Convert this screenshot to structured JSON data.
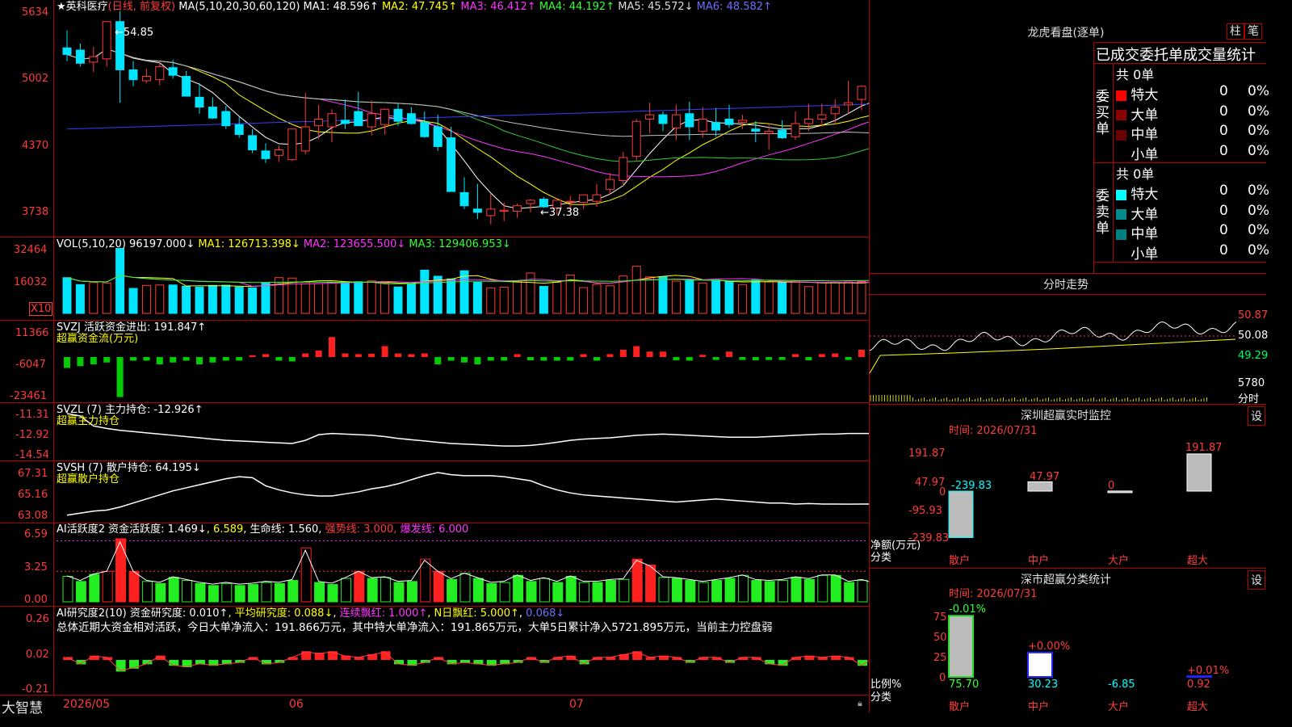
{
  "colors": {
    "up": "#ff3b3b",
    "down": "#00e5ff",
    "border": "#b00000",
    "ma1": "#ffffff",
    "ma2": "#ffff00",
    "ma3": "#ff33ff",
    "ma4": "#33cc33",
    "ma5": "#c0c0c0",
    "ma6": "#3b3bff"
  },
  "header": {
    "star": "★",
    "stock": "英科医疗",
    "period": "(日线, 前复权)",
    "ma_def": "MA(5,10,20,30,60,120)",
    "ma1": "MA1: 48.596↑",
    "ma2": "MA2: 47.745↑",
    "ma3": "MA3: 46.412↑",
    "ma4": "MA4: 44.192↑",
    "ma5": "MA5: 45.572↓",
    "ma6": "MA6: 48.582↑"
  },
  "price_axis": [
    "5634",
    "5002",
    "4370",
    "3738"
  ],
  "price_annot": {
    "high": "←54.85",
    "low": "←37.38"
  },
  "vol": {
    "def": "VOL(5,10,20)",
    "v": "96197.000↓",
    "ma1": "MA1: 126713.398↓",
    "ma2": "MA2: 123655.500↓",
    "ma3": "MA3: 129406.953↓",
    "axis": [
      "32464",
      "16032"
    ],
    "unit": "X10"
  },
  "svzj": {
    "title": "SVZJ  活跃资金进出: 191.847↑",
    "sub": "超赢资金流(万元)",
    "axis": [
      "11366",
      "-6047",
      "-23461"
    ]
  },
  "svzl": {
    "title": "SVZL (7) 主力持仓: -12.926↑",
    "sub": "超赢主力持仓",
    "axis": [
      "-11.31",
      "-12.92",
      "-14.54"
    ]
  },
  "svsh": {
    "title": "SVSH (7) 散户持仓: 64.195↓",
    "sub": "超赢散户持仓",
    "axis": [
      "67.31",
      "65.16",
      "63.08"
    ]
  },
  "ai1": {
    "title": "AI活跃度2 资金活跃度: 1.469↓",
    "v2": "6.589",
    "life": "生命线: 1.560",
    "strong": "强势线: 3.000",
    "burst": "爆发线: 6.000",
    "axis": [
      "6.59",
      "3.25",
      "0.00"
    ]
  },
  "ai2": {
    "title": "AI研究度2(10) 资金研究度: 0.010↑",
    "avg": "平均研究度: 0.088↓",
    "lx": "连续飘红: 1.000↑",
    "nr": "N日飘红: 5.000↑",
    "last": "0.068↓",
    "note": "总体近期大资金相对活跃，今日大单净流入：191.866万元，其中特大单净流入：191.865万元，大单5日累计净入5721.895万元，当前主力控盘弱",
    "axis": [
      "0.26",
      "0.02",
      "-0.21"
    ]
  },
  "bottom": {
    "logo": "大智慧",
    "dates": [
      "2026/05",
      "06",
      "07"
    ]
  },
  "right": {
    "lhkp": {
      "title": "龙虎看盘(逐单)",
      "btn1": "柱",
      "btn2": "笔",
      "head": "已成交委托单成交量统计",
      "buy": {
        "side": "委买单",
        "total": "共 0单",
        "rows": [
          {
            "name": "特大",
            "v": "0",
            "p": "0%",
            "c": "#ff0000"
          },
          {
            "name": "大单",
            "v": "0",
            "p": "0%",
            "c": "#8b0000"
          },
          {
            "name": "中单",
            "v": "0",
            "p": "0%",
            "c": "#6a0000"
          },
          {
            "name": "小单",
            "v": "0",
            "p": "0%",
            "c": "#000000"
          }
        ]
      },
      "sell": {
        "side": "委卖单",
        "total": "共 0单",
        "rows": [
          {
            "name": "特大",
            "v": "0",
            "p": "0%",
            "c": "#00ffff"
          },
          {
            "name": "大单",
            "v": "0",
            "p": "0%",
            "c": "#008b8b"
          },
          {
            "name": "中单",
            "v": "0",
            "p": "0%",
            "c": "#008080"
          },
          {
            "name": "小单",
            "v": "0",
            "p": "0%",
            "c": "#000000"
          }
        ]
      }
    },
    "fs": {
      "title": "分时走势",
      "axis": [
        "50.87",
        "50.08",
        "49.29"
      ],
      "vol": "5780",
      "unit": "分时"
    },
    "sz": {
      "title": "深圳超赢实时监控",
      "btn": "设",
      "time": "时间: 2026/07/31",
      "axis": [
        "191.87",
        "47.97",
        "0",
        "-95.93",
        "-239.83"
      ],
      "labels": [
        "-239.83",
        "47.97",
        "0",
        "191.87"
      ],
      "cats": [
        "散户",
        "中户",
        "大户",
        "超大"
      ],
      "ylbl": "净额(万元)",
      "xlbl": "分类",
      "values": [
        -239.83,
        47.97,
        0.5,
        191.87
      ]
    },
    "sc": {
      "title": "深市超赢分类统计",
      "btn": "设",
      "time": "时间: 2026/07/31",
      "axis": [
        "75",
        "50",
        "25",
        "0"
      ],
      "top": [
        "-0.01%",
        "+0.00%",
        "",
        "+0.01%"
      ],
      "bot": [
        "75.70",
        "30.23",
        "-6.85",
        "0.92"
      ],
      "cats": [
        "散户",
        "中户",
        "大户",
        "超大"
      ],
      "ylbl": "比例%",
      "xlbl": "分类",
      "values": [
        75.7,
        30.23,
        0,
        0.92
      ]
    }
  },
  "chart_data": {
    "type": "candlestick",
    "price": {
      "open": [
        5300,
        5280,
        5170,
        5200,
        5540,
        5100,
        5000,
        5010,
        5120,
        5040,
        4850,
        4760,
        4720,
        4600,
        4500,
        4360,
        4320,
        4280,
        4360,
        4590,
        4580,
        4640,
        4720,
        4580,
        4600,
        4740,
        4700,
        4620,
        4580,
        4480,
        3980,
        3830,
        3770,
        3810,
        3810,
        3880,
        3920,
        3840,
        3900,
        3890,
        3900,
        4010,
        4090,
        4310,
        4650,
        4690,
        4570,
        4700,
        4540,
        4620,
        4650,
        4620,
        4560,
        4520,
        4550,
        4490,
        4610,
        4650,
        4700,
        4780,
        4830,
        4960,
        4900,
        4980,
        5010
      ],
      "high": [
        5460,
        5340,
        5310,
        5500,
        5634,
        5180,
        5110,
        5170,
        5190,
        5090,
        4980,
        4850,
        4770,
        4670,
        4560,
        4430,
        4410,
        4460,
        4890,
        4780,
        4740,
        4830,
        4900,
        4820,
        4750,
        4790,
        4760,
        4720,
        4690,
        4580,
        4120,
        4060,
        3970,
        3890,
        3880,
        3920,
        3940,
        3930,
        3950,
        3960,
        4060,
        4160,
        4350,
        4650,
        4800,
        4720,
        4780,
        4810,
        4760,
        4750,
        4780,
        4690,
        4630,
        4610,
        4640,
        4720,
        4790,
        4790,
        4830,
        5000,
        4960,
        5080,
        5100,
        5080,
        5040
      ],
      "low": [
        5180,
        5130,
        5080,
        5130,
        4800,
        4950,
        4980,
        4960,
        5020,
        4880,
        4700,
        4650,
        4560,
        4480,
        4340,
        4250,
        4260,
        4270,
        4330,
        4470,
        4440,
        4560,
        4610,
        4500,
        4510,
        4590,
        4600,
        4480,
        4360,
        4200,
        3830,
        3738,
        3690,
        3720,
        3750,
        3800,
        3840,
        3780,
        3810,
        3830,
        3850,
        3960,
        4040,
        4270,
        4520,
        4540,
        4460,
        4460,
        4480,
        4490,
        4570,
        4560,
        4440,
        4370,
        4470,
        4460,
        4540,
        4580,
        4600,
        4700,
        4730,
        4900,
        4850,
        4880,
        4900
      ],
      "close": [
        5240,
        5160,
        5220,
        5540,
        5100,
        5010,
        5040,
        5130,
        5050,
        4860,
        4760,
        4660,
        4590,
        4510,
        4370,
        4290,
        4370,
        4560,
        4580,
        4650,
        4700,
        4610,
        4590,
        4700,
        4740,
        4630,
        4610,
        4490,
        4400,
        3990,
        3860,
        3800,
        3830,
        3820,
        3860,
        3910,
        3850,
        3910,
        3900,
        3960,
        3960,
        4100,
        4300,
        4630,
        4690,
        4610,
        4690,
        4580,
        4650,
        4550,
        4600,
        4640,
        4540,
        4540,
        4480,
        4610,
        4650,
        4690,
        4760,
        4800,
        4950,
        4880,
        4980,
        5010,
        4960
      ]
    },
    "volume": [
      176,
      142,
      152,
      150,
      320,
      123,
      138,
      140,
      140,
      134,
      130,
      138,
      139,
      130,
      126,
      152,
      176,
      174,
      154,
      147,
      154,
      154,
      156,
      160,
      149,
      130,
      143,
      213,
      183,
      170,
      210,
      153,
      126,
      129,
      156,
      199,
      133,
      153,
      189,
      127,
      143,
      136,
      184,
      232,
      180,
      181,
      159,
      161,
      150,
      164,
      158,
      142,
      164,
      155,
      153,
      162,
      132,
      152,
      153,
      155,
      157,
      158,
      155,
      153,
      154
    ],
    "svzj": [
      -3,
      -2.5,
      -2,
      -1.5,
      -11,
      -1,
      -1,
      -2,
      -1.5,
      -1,
      -2,
      -1.5,
      -1,
      -1,
      0.5,
      0.8,
      -1,
      -1.2,
      1,
      1.8,
      5.5,
      1,
      0.8,
      0.9,
      3,
      1,
      0.8,
      1,
      -2,
      -1,
      -1.5,
      -2,
      -1,
      -1,
      0.8,
      -0.9,
      -1,
      -1,
      -1,
      0.8,
      -1,
      0.8,
      2,
      3,
      1.5,
      1.5,
      -0.9,
      -1,
      0.6,
      -0.8,
      1.5,
      -0.8,
      -0.9,
      -0.8,
      -0.8,
      0.8,
      -0.9,
      0.8,
      1,
      -0.8,
      2,
      0.8,
      -0.8,
      0.8,
      -1
    ],
    "svzl": [
      -11.31,
      -11.5,
      -12.3,
      -12.5,
      -12.65,
      -12.75,
      -12.85,
      -12.95,
      -13.05,
      -13.15,
      -13.25,
      -13.35,
      -13.45,
      -13.5,
      -13.55,
      -13.6,
      -13.65,
      -13.7,
      -13.45,
      -13.0,
      -12.9,
      -12.95,
      -13.0,
      -13.05,
      -13.15,
      -13.3,
      -13.4,
      -13.5,
      -13.6,
      -13.7,
      -13.75,
      -13.8,
      -13.85,
      -13.9,
      -13.9,
      -13.85,
      -13.75,
      -13.6,
      -13.45,
      -13.35,
      -13.3,
      -13.25,
      -13.15,
      -13.05,
      -13.0,
      -12.95,
      -13.0,
      -13.05,
      -13.1,
      -13.15,
      -13.2,
      -13.2,
      -13.2,
      -13.15,
      -13.1,
      -13.05,
      -13.0,
      -12.95,
      -12.95,
      -12.9,
      -12.9,
      -12.9,
      -12.95,
      -12.93,
      -12.93
    ],
    "svsh": [
      63.1,
      63.3,
      63.5,
      63.6,
      63.9,
      64.3,
      64.7,
      65.1,
      65.5,
      65.8,
      66.1,
      66.4,
      66.7,
      66.9,
      66.8,
      66.0,
      65.6,
      65.3,
      65.1,
      65.0,
      65.0,
      65.2,
      65.4,
      65.7,
      65.9,
      66.2,
      66.6,
      67.0,
      67.31,
      67.1,
      67.0,
      67.0,
      67.0,
      66.9,
      66.7,
      66.5,
      66.0,
      65.6,
      65.3,
      65.1,
      65.0,
      64.9,
      64.8,
      64.7,
      64.6,
      64.5,
      64.4,
      64.5,
      64.6,
      64.7,
      64.6,
      64.5,
      64.4,
      64.3,
      64.3,
      64.2,
      64.25,
      64.2,
      64.2,
      64.19,
      64.2,
      64.19,
      64.195,
      64.2,
      64.195
    ],
    "ai1": [
      2.5,
      2,
      2.7,
      3,
      6.2,
      3,
      2,
      1.8,
      2.4,
      2.1,
      1.8,
      1.6,
      1.8,
      1.6,
      1.7,
      1.9,
      1.8,
      2.1,
      5.3,
      1.9,
      1.7,
      2.3,
      3,
      2.3,
      2.4,
      1.9,
      2,
      4.2,
      3,
      2.2,
      2.8,
      2.3,
      1.8,
      1.9,
      2.6,
      2,
      2.3,
      1.9,
      2.5,
      1.9,
      1.9,
      2.1,
      2.2,
      4.2,
      3.6,
      2.4,
      2.3,
      2.1,
      1.9,
      2.1,
      2.3,
      2.6,
      2.1,
      2,
      2.1,
      2.4,
      2.2,
      2.6,
      2.6,
      1.9,
      2.1,
      1.7,
      3.6,
      2.3,
      1.5
    ],
    "ai2": [
      0.02,
      -0.03,
      0.03,
      0.02,
      -0.08,
      -0.06,
      -0.03,
      0.03,
      -0.04,
      -0.05,
      -0.03,
      -0.04,
      -0.03,
      -0.02,
      0.02,
      -0.03,
      -0.02,
      0.02,
      0.06,
      0.05,
      0.06,
      0.03,
      0.02,
      0.04,
      0.06,
      -0.03,
      -0.04,
      -0.02,
      0.02,
      -0.03,
      -0.02,
      -0.03,
      -0.04,
      -0.03,
      -0.02,
      0.02,
      -0.02,
      0.02,
      0.03,
      -0.03,
      0.02,
      0.02,
      0.04,
      0.06,
      0.02,
      0.03,
      0.02,
      -0.02,
      0.02,
      0.02,
      -0.02,
      0.02,
      0.02,
      -0.03,
      -0.04,
      0.02,
      0.03,
      0.02,
      0.03,
      0.02,
      -0.04,
      0.02,
      0.04,
      0.02,
      0.01
    ]
  }
}
